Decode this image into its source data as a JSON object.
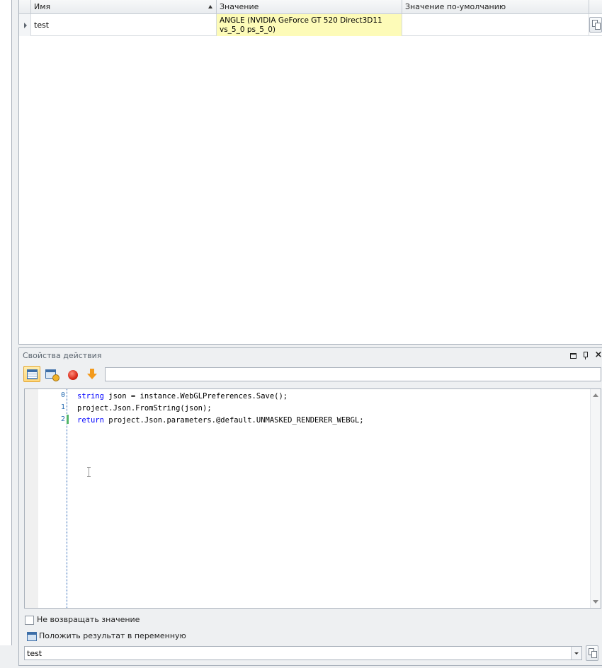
{
  "grid": {
    "columns": [
      {
        "label": "Имя",
        "sorted": "ascending"
      },
      {
        "label": "Значение"
      },
      {
        "label": "Значение по-умолчанию"
      }
    ],
    "rows": [
      {
        "name": "test",
        "value": "ANGLE (NVIDIA GeForce GT 520 Direct3D11 vs_5_0 ps_5_0)",
        "default": ""
      }
    ],
    "copy_button_icon": "copy-icon"
  },
  "panel": {
    "title": "Свойства действия",
    "controls": [
      "maximize-icon",
      "pin-icon",
      "close-icon"
    ],
    "close_glyph": "×",
    "toolbar": {
      "buttons": [
        "table-view-icon",
        "form-view-icon",
        "stop-icon",
        "arrow-down-icon"
      ],
      "input_value": ""
    },
    "code": {
      "line_numbers": [
        "0",
        "1",
        "2"
      ],
      "lines": [
        {
          "kw": "string",
          "rest": " json = instance.WebGLPreferences.Save();"
        },
        {
          "kw": "",
          "rest": "project.Json.FromString(json);"
        },
        {
          "kw": "return",
          "rest": " project.Json.parameters.@default.UNMASKED_RENDERER_WEBGL;"
        }
      ]
    },
    "no_return_label": "Не возвращать значение",
    "no_return_checked": false,
    "save_result_label": "Положить результат в переменную",
    "variable_value": "test"
  },
  "colors": {
    "value_highlight": "#fdfbb8",
    "keyword": "#0000ff",
    "line_numbers": "#2b6fb3",
    "modified_marker": "#53b66a"
  }
}
